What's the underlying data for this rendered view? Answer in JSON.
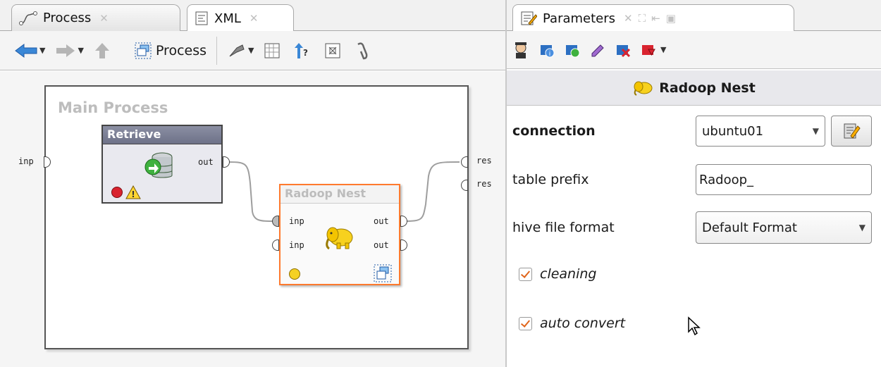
{
  "left_tabs": [
    {
      "label": "Process",
      "active": false
    },
    {
      "label": "XML",
      "active": true
    }
  ],
  "toolbar": {
    "process_label": "Process"
  },
  "canvas": {
    "title": "Main Process",
    "input_port": "inp",
    "output_ports": [
      "res",
      "res"
    ]
  },
  "retrieve": {
    "title": "Retrieve",
    "out_port": "out"
  },
  "nest": {
    "title": "Radoop Nest",
    "in_ports": [
      "inp",
      "inp"
    ],
    "out_ports": [
      "out",
      "out"
    ]
  },
  "right_tabs": [
    {
      "label": "Parameters",
      "active": true
    }
  ],
  "params": {
    "title": "Radoop Nest",
    "connection": {
      "label": "connection",
      "value": "ubuntu01"
    },
    "table_prefix": {
      "label": "table prefix",
      "value": "Radoop_"
    },
    "hive_format": {
      "label": "hive file format",
      "value": "Default Format"
    },
    "cleaning": {
      "label": "cleaning",
      "checked": true
    },
    "auto_convert": {
      "label": "auto convert",
      "checked": true
    }
  },
  "colors": {
    "accent": "#ff7a2e",
    "check": "#e0651b",
    "header": "#6d7188"
  }
}
